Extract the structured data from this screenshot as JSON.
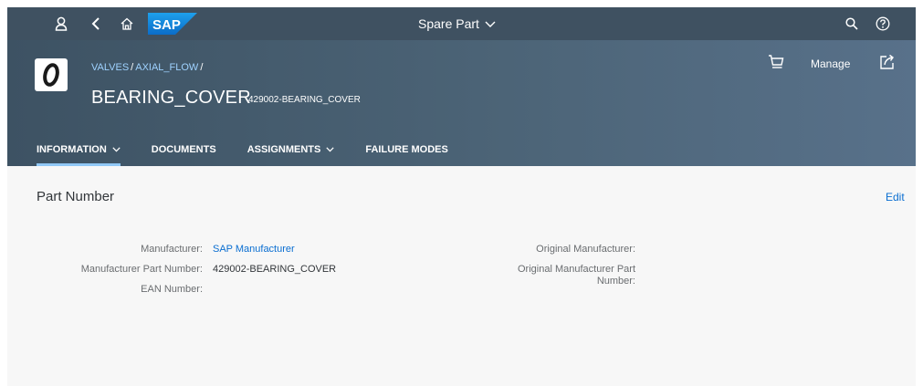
{
  "shell": {
    "title": "Spare Part",
    "logo_text": "SAP",
    "icons": [
      "user-icon",
      "back-icon",
      "home-icon",
      "search-icon",
      "help-icon"
    ]
  },
  "header": {
    "breadcrumb": [
      "VALVES",
      "AXIAL_FLOW"
    ],
    "title": "BEARING_COVER",
    "subtitle": "429002-BEARING_COVER",
    "manage_label": "Manage",
    "tabs": [
      {
        "label": "INFORMATION",
        "has_menu": true,
        "active": true
      },
      {
        "label": "DOCUMENTS",
        "has_menu": false,
        "active": false
      },
      {
        "label": "ASSIGNMENTS",
        "has_menu": true,
        "active": false
      },
      {
        "label": "FAILURE MODES",
        "has_menu": false,
        "active": false
      }
    ]
  },
  "section": {
    "title": "Part Number",
    "edit_label": "Edit",
    "left_fields": [
      {
        "label": "Manufacturer:",
        "value": "SAP Manufacturer"
      },
      {
        "label": "Manufacturer Part Number:",
        "value": "429002-BEARING_COVER"
      },
      {
        "label": "EAN Number:",
        "value": ""
      }
    ],
    "right_fields": [
      {
        "label": "Original Manufacturer:",
        "value": ""
      },
      {
        "label_line1": "Original Manufacturer Part",
        "label_line2": "Number:",
        "value": ""
      }
    ]
  },
  "colors": {
    "shell_bg": "#3f5161",
    "header_bg": "#4c6477",
    "link": "#0a6ed1",
    "breadcrumb_link": "#9fd2ff",
    "tab_indicator": "#91c8f6",
    "content_bg": "#f7f7f7"
  }
}
